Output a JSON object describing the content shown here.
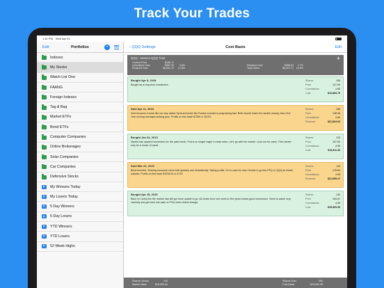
{
  "headline": "Track Your Trades",
  "status": {
    "time": "1:41 PM",
    "date": "Wed Apr 24"
  },
  "sidebar": {
    "edit_label": "Edit",
    "title": "Portfolios",
    "add_label": "+",
    "items": [
      {
        "label": "Indexes",
        "icon": "folder-icon"
      },
      {
        "label": "My Stocks",
        "icon": "folder-icon"
      },
      {
        "label": "Watch List One",
        "icon": "folder-icon"
      },
      {
        "label": "FAANG",
        "icon": "folder-icon"
      },
      {
        "label": "Foreign Indexes",
        "icon": "folder-icon"
      },
      {
        "label": "Tag & Bag",
        "icon": "folder-icon"
      },
      {
        "label": "Market ETFs",
        "icon": "folder-icon"
      },
      {
        "label": "Bond ETFs",
        "icon": "folder-icon"
      },
      {
        "label": "Computer Companies",
        "icon": "folder-icon"
      },
      {
        "label": "Online Brokerages",
        "icon": "folder-icon"
      },
      {
        "label": "Solar Companies",
        "icon": "folder-icon"
      },
      {
        "label": "Car Companies",
        "icon": "folder-icon"
      },
      {
        "label": "Defensive Stocks",
        "icon": "folder-icon"
      },
      {
        "label": "My Winners Today",
        "icon": "filter-icon"
      },
      {
        "label": "My Losers Today",
        "icon": "filter-icon"
      },
      {
        "label": "5 Day Winners",
        "icon": "filter-icon"
      },
      {
        "label": "5 Day Losers",
        "icon": "filter-icon"
      },
      {
        "label": "YTD Winners",
        "icon": "filter-icon"
      },
      {
        "label": "YTD Losers",
        "icon": "filter-icon"
      },
      {
        "label": "52 Week Highs",
        "icon": "filter-icon"
      }
    ]
  },
  "detail": {
    "back_label": "QQQ Settings",
    "title": "Cost Basis",
    "edit_label": "Edit",
    "summary": {
      "title": "QQQ - Invesco QQQ Trust",
      "add_label": "+",
      "rows": [
        {
          "k": "Current Price",
          "v": "$188.71",
          "p": "",
          "k2": "",
          "v2": "",
          "p2": ""
        },
        {
          "k": "Unrealized Gain",
          "v": "$987.25",
          "p": "3.8%",
          "k2": "Dividend Gain",
          "v2": "$388.60",
          "p2": "2.7%"
        },
        {
          "k": "Realized Gain",
          "v": "$6,850.70",
          "p": "12.8%",
          "k2": "Total Gains",
          "v2": "$8,227.17",
          "p2": "15.9%"
        }
      ]
    },
    "trades": [
      {
        "kind": "buy",
        "header": "Bought  Apr 8, 2018",
        "note": "Bought as a long term investment.",
        "shares_label": "Shares",
        "shares": "158",
        "price_label": "Price",
        "price": "107.69",
        "commission_label": "Commission",
        "commission": "4.95",
        "total_label": "Cost",
        "total": "$16,884.79"
      },
      {
        "kind": "sell",
        "header": "Sold  Apr 11, 2018",
        "note": "Sold because it looks like we may attack Syria and looks like Russia scandal is progressing fast. Both should make the market uneasy. Also One Year moving averages looking poor. Profits on this trade $7369 or 45.6%",
        "shares_label": "Shares",
        "shares": "158",
        "price_label": "Price",
        "price": "138.28",
        "commission_label": "Commission",
        "commission": "4.95",
        "total_label": "Revenue",
        "total": "$21,804.63"
      },
      {
        "kind": "buy",
        "header": "Bought  Jan 31, 2019",
        "note": "Market has upward momentum for the past month.  Fed is no longer eager to raise rates.  Let's go with the market.  Look out for crash.  This market may be a house of cards.",
        "shares_label": "Shares",
        "shares": "116",
        "price_label": "Price",
        "price": "167.85",
        "commission_label": "Commission",
        "commission": "4.95",
        "total_label": "Cost",
        "total": "$19,811.35"
      },
      {
        "kind": "sell",
        "header": "Sold  Mar 22, 2019",
        "note": "Bond inverted.  Slowing  economic news both globally and domestically.  Taking profits.  Go to cash for now.  Decide to go into PSQ or QQQ as charts indicate.  Profits on this trade $1238.54 or 6.3%",
        "shares_label": "Shares",
        "shares": "116",
        "price_label": "Price",
        "price": "178.84",
        "commission_label": "Commission",
        "commission": "4.95",
        "total_label": "Revenue",
        "total": "$21,099.17"
      },
      {
        "kind": "buy",
        "header": "Bought  Apr 15, 2019",
        "note": "Back in!  Looks like the market has still got more upside to go.  All charts from one week to five years shows good momentum.  Need to watch very carefully and get back into cash or PSQ when charts change.",
        "shares_label": "Shares",
        "shares": "140",
        "price_label": "Price",
        "price": "184.91",
        "commission_label": "Commission",
        "commission": "4.95",
        "total_label": "Cost",
        "total": "$25,893.35"
      }
    ],
    "footer": {
      "rows": [
        {
          "k": "Shares Owned",
          "v": "140",
          "k2": "Shares Sold",
          "v2": "250"
        },
        {
          "k": "Market Value",
          "v": "$26,359.40",
          "k2": "Cost Basis",
          "v2": "$25,692.35"
        }
      ]
    }
  }
}
